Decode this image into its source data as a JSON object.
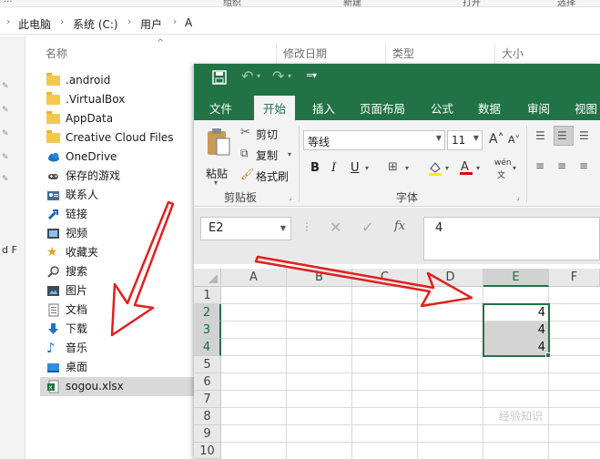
{
  "explorer": {
    "top_strip": [
      "...",
      "组织",
      "新建",
      "打开",
      "选择"
    ],
    "address": [
      "此电脑",
      "系统 (C:)",
      "用户",
      "A"
    ],
    "columns": {
      "name": "名称",
      "date": "修改日期",
      "type": "类型",
      "size": "大小"
    },
    "left_fragment": "d F",
    "nav_items": [
      {
        "label": ".android",
        "icon": "folder-icon"
      },
      {
        "label": ".VirtualBox",
        "icon": "folder-icon"
      },
      {
        "label": "AppData",
        "icon": "folder-icon"
      },
      {
        "label": "Creative Cloud Files",
        "icon": "folder-icon"
      },
      {
        "label": "OneDrive",
        "icon": "onedrive-icon"
      },
      {
        "label": "保存的游戏",
        "icon": "saved-games-icon"
      },
      {
        "label": "联系人",
        "icon": "contacts-icon"
      },
      {
        "label": "链接",
        "icon": "links-icon"
      },
      {
        "label": "视频",
        "icon": "videos-icon"
      },
      {
        "label": "收藏夹",
        "icon": "favorites-star-icon"
      },
      {
        "label": "搜索",
        "icon": "search-icon"
      },
      {
        "label": "图片",
        "icon": "pictures-icon"
      },
      {
        "label": "文档",
        "icon": "documents-icon"
      },
      {
        "label": "下载",
        "icon": "download-arrow-icon"
      },
      {
        "label": "音乐",
        "icon": "music-note-icon"
      },
      {
        "label": "桌面",
        "icon": "desktop-icon"
      },
      {
        "label": "sogou.xlsx",
        "icon": "excel-file-icon"
      }
    ]
  },
  "excel": {
    "tabs": [
      "文件",
      "开始",
      "插入",
      "页面布局",
      "公式",
      "数据",
      "审阅",
      "视图"
    ],
    "active_tab": "开始",
    "clipboard": {
      "paste": "粘贴",
      "cut": "剪切",
      "copy": "复制",
      "format_painter": "格式刷",
      "group": "剪贴板"
    },
    "font": {
      "name": "等线",
      "size": "11",
      "bold": "B",
      "italic": "I",
      "underline": "U",
      "phonetic": "wén",
      "group": "字体"
    },
    "name_box": "E2",
    "formula_value": "4",
    "columns": [
      "A",
      "B",
      "C",
      "D",
      "E",
      "F"
    ],
    "rows": [
      "1",
      "2",
      "3",
      "4",
      "5",
      "6",
      "7",
      "8",
      "9",
      "10"
    ],
    "cells": {
      "E2": "4",
      "E3": "4",
      "E4": "4"
    },
    "selected_column": "E",
    "selected_rows": [
      "2",
      "3",
      "4"
    ]
  },
  "colors": {
    "excel_green": "#217346",
    "arrow_red": "#e02020",
    "folder_yellow": "#f5c84c"
  },
  "watermark": "经验知识"
}
